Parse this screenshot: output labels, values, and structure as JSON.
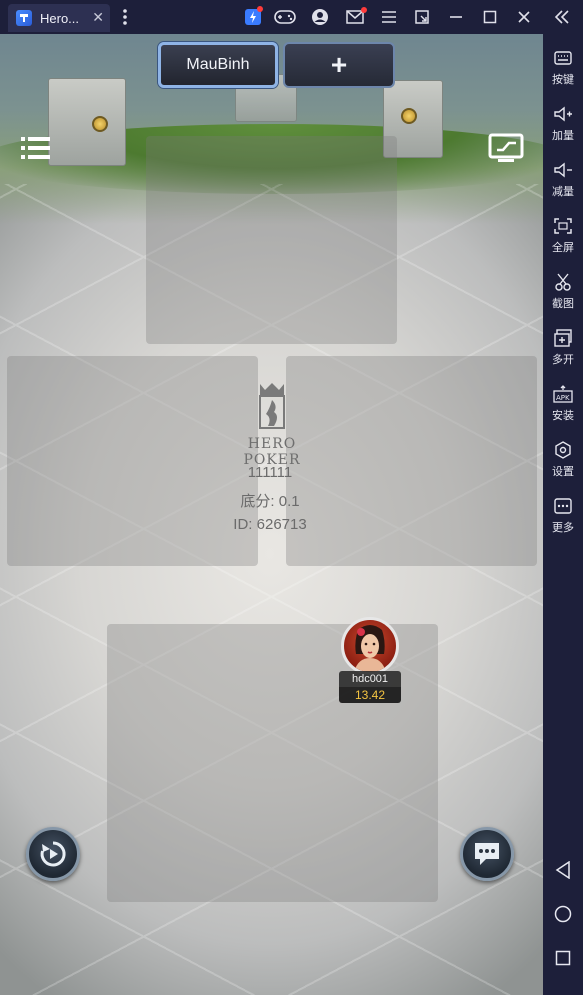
{
  "titlebar": {
    "tab_title": "Hero...",
    "tab_icon": "app-icon",
    "icons": [
      "more-vert-icon",
      "boost-icon",
      "gamepad-icon",
      "account-icon",
      "mail-icon",
      "menu-icon",
      "window-restore-icon",
      "minimize-icon",
      "maximize-icon",
      "close-icon",
      "collapse-sidebar-icon"
    ]
  },
  "sidebar": {
    "items": [
      {
        "label": "按键",
        "icon": "keyboard-icon"
      },
      {
        "label": "加量",
        "icon": "volume-up-icon"
      },
      {
        "label": "减量",
        "icon": "volume-down-icon"
      },
      {
        "label": "全屏",
        "icon": "fullscreen-icon"
      },
      {
        "label": "截图",
        "icon": "scissors-icon"
      },
      {
        "label": "多开",
        "icon": "multi-instance-icon"
      },
      {
        "label": "安装",
        "icon": "apk-install-icon"
      },
      {
        "label": "设置",
        "icon": "settings-icon"
      },
      {
        "label": "更多",
        "icon": "more-icon"
      }
    ],
    "nav": [
      "back-icon",
      "home-icon",
      "recents-icon"
    ]
  },
  "game": {
    "tab_active": "MauBinh",
    "tab_add": "+",
    "logo_text": "HERO POKER",
    "room_name": "111111",
    "base_bet": "底分: 0.1",
    "room_id": "ID: 626713",
    "player": {
      "name": "hdc001",
      "balance": "13.42"
    }
  },
  "colors": {
    "chrome": "#1d1f3a",
    "balance": "#f5c542",
    "active_tab_border": "#8fb4e6"
  }
}
